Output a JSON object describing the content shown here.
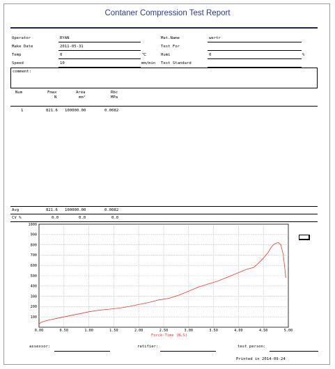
{
  "report": {
    "title": "Contaner Compression Test Report"
  },
  "fields": {
    "operator_label": "Operator",
    "operator_value": "RYAN",
    "make_date_label": "Make Date",
    "make_date_value": "2011-05-31",
    "temp_label": "Temp",
    "temp_value": "0",
    "temp_unit": "℃",
    "speed_label": "Speed",
    "speed_value": "10",
    "speed_unit": "mm/min",
    "mat_name_label": "Mat.Name",
    "mat_name_value": "wertr",
    "test_for_label": "Test For",
    "test_for_value": "",
    "humi_label": "Humi",
    "humi_value": "0",
    "humi_unit": "%",
    "test_standard_label": "Test Standard",
    "test_standard_value": "",
    "comment_label": "comment:"
  },
  "table": {
    "headers": [
      {
        "name": "Num",
        "unit": ""
      },
      {
        "name": "Fmax",
        "unit": "N"
      },
      {
        "name": "Area",
        "unit": "mm²"
      },
      {
        "name": "Rbc",
        "unit": "MPa"
      }
    ],
    "rows": [
      {
        "num": "1",
        "fmax": "821.6",
        "area": "100000.00",
        "rbc": "0.0082"
      }
    ],
    "avg": {
      "label": "Avg",
      "fmax": "821.6",
      "area": "100000.00",
      "rbc": "0.0082"
    },
    "cv": {
      "label": "CV %",
      "fmax": "0.0",
      "area": "0.0",
      "rbc": "0.0"
    }
  },
  "chart_data": {
    "type": "line",
    "xlabel": "Force-Time  (N,S)",
    "ylabel": "",
    "xlim": [
      0,
      5
    ],
    "ylim": [
      0,
      1000
    ],
    "x_ticks": [
      "0.00",
      "0.50",
      "1.00",
      "1.50",
      "2.00",
      "2.50",
      "3.00",
      "3.50",
      "4.00",
      "4.50",
      "5.00"
    ],
    "y_ticks": [
      "1000",
      "900",
      "800",
      "700",
      "600",
      "500",
      "400",
      "300",
      "200",
      "100"
    ],
    "grid": true,
    "line_color": "#ff3030",
    "series": [
      {
        "x": [
          0.0,
          0.05,
          0.2,
          0.4,
          0.6,
          0.8,
          1.0,
          1.2,
          1.4,
          1.6,
          1.8,
          2.0,
          2.2,
          2.4,
          2.6,
          2.8,
          3.0,
          3.2,
          3.4,
          3.6,
          3.8,
          4.0,
          4.15,
          4.3,
          4.4,
          4.5,
          4.55,
          4.6,
          4.65,
          4.7,
          4.75,
          4.8,
          4.85,
          4.9,
          4.95
        ],
        "y": [
          30,
          50,
          70,
          90,
          110,
          130,
          150,
          165,
          175,
          185,
          200,
          220,
          240,
          265,
          280,
          310,
          350,
          390,
          420,
          450,
          490,
          530,
          560,
          580,
          620,
          670,
          700,
          730,
          770,
          800,
          815,
          821,
          800,
          700,
          480
        ]
      }
    ]
  },
  "signatures": {
    "assessor_label": "assessor:",
    "ratifier_label": "ratifier:",
    "test_person_label": "test person:",
    "printed": "Printed in 2014-09-24"
  }
}
